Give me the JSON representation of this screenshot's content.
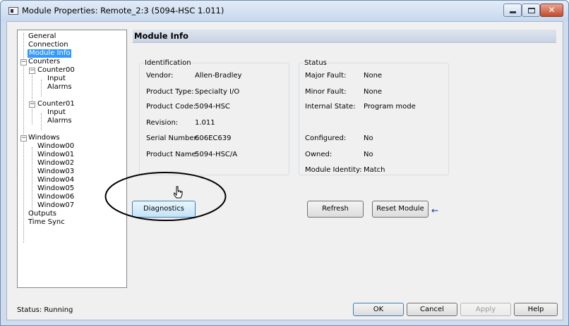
{
  "window": {
    "title": "Module Properties: Remote_2:3 (5094-HSC 1.011)",
    "icon": "application-icon",
    "controls": {
      "minimize": "minimize-icon",
      "maximize": "maximize-icon",
      "close": "✕"
    }
  },
  "tree": {
    "items": [
      "General",
      "Connection",
      "Module Info",
      "Counters",
      "Counter00",
      "Input",
      "Alarms",
      "Counter01",
      "Input",
      "Alarms",
      "Windows",
      "Window00",
      "Window01",
      "Window02",
      "Window03",
      "Window04",
      "Window05",
      "Window06",
      "Window07",
      "Outputs",
      "Time Sync"
    ],
    "selected": "Module Info",
    "expand_glyph": "−"
  },
  "panel": {
    "title": "Module Info"
  },
  "identification": {
    "title": "Identification",
    "rows": [
      {
        "label": "Vendor:",
        "value": "Allen-Bradley"
      },
      {
        "label": "Product Type:",
        "value": "Specialty I/O"
      },
      {
        "label": "Product Code:",
        "value": "5094-HSC"
      },
      {
        "label": "Revision:",
        "value": "1.011"
      },
      {
        "label": "Serial Number:",
        "value": "606EC639"
      },
      {
        "label": "Product Name:",
        "value": "5094-HSC/A"
      }
    ]
  },
  "status_group": {
    "title": "Status",
    "rows": [
      {
        "label": "Major Fault:",
        "value": "None"
      },
      {
        "label": "Minor Fault:",
        "value": "None"
      },
      {
        "label": "Internal State:",
        "value": "Program mode"
      },
      {
        "label": "Configured:",
        "value": "No"
      },
      {
        "label": "Owned:",
        "value": "No"
      },
      {
        "label": "Module Identity:",
        "value": "Match"
      }
    ]
  },
  "buttons": {
    "diagnostics": "Diagnostics",
    "refresh": "Refresh",
    "reset_module": "Reset Module",
    "ok": "OK",
    "cancel": "Cancel",
    "apply": "Apply",
    "help": "Help"
  },
  "annotation": {
    "arrow": "←"
  },
  "footer": {
    "status": "Status:  Running"
  },
  "colors": {
    "selection": "#3399ff",
    "accent_arrow": "#1d2fa8",
    "close_button": "#c34a2c"
  }
}
